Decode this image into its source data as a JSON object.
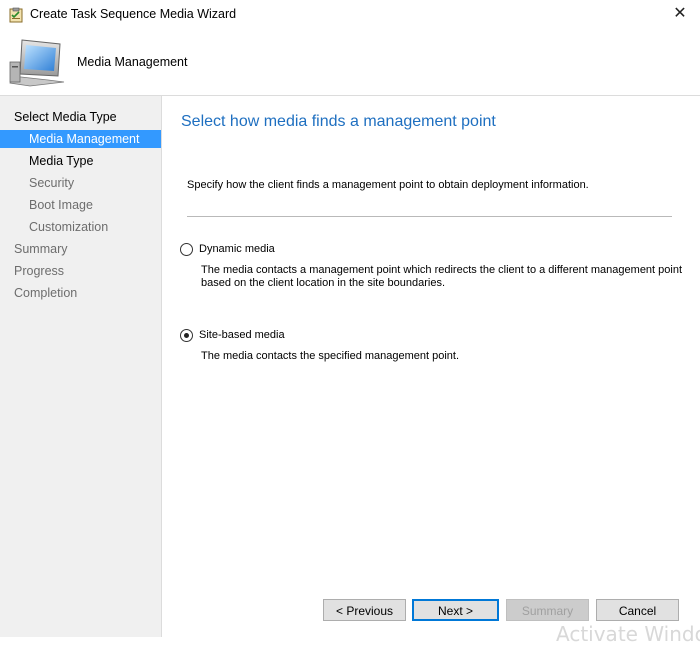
{
  "window": {
    "title": "Create Task Sequence Media Wizard",
    "close_glyph": "✕"
  },
  "header": {
    "title": "Media Management"
  },
  "nav": {
    "items": [
      {
        "label": "Select Media Type",
        "state": "normal"
      },
      {
        "label": "Media Management",
        "state": "selected"
      },
      {
        "label": "Media Type",
        "state": "normal"
      },
      {
        "label": "Security",
        "state": "dim"
      },
      {
        "label": "Boot Image",
        "state": "dim"
      },
      {
        "label": "Customization",
        "state": "dim"
      },
      {
        "label": "Summary",
        "state": "dim"
      },
      {
        "label": "Progress",
        "state": "dim"
      },
      {
        "label": "Completion",
        "state": "dim"
      }
    ]
  },
  "main": {
    "heading": "Select how media finds a management point",
    "instruction": "Specify how the client finds a management point to obtain deployment information.",
    "options": [
      {
        "label": "Dynamic media",
        "checked": false,
        "description_lines": [
          "The media contacts a management point which redirects the client to a different management point",
          "based on the client location in the site boundaries."
        ]
      },
      {
        "label": "Site-based media",
        "checked": true,
        "description_lines": [
          "The media contacts the specified management point."
        ]
      }
    ]
  },
  "buttons": {
    "previous": "< Previous",
    "next": "Next >",
    "summary": "Summary",
    "cancel": "Cancel"
  },
  "watermark": "Activate Windows",
  "colors": {
    "accent": "#3399ff",
    "heading": "#1e6fc0",
    "nav_background": "#f0f0f0"
  },
  "icons": {
    "title": "wizard-clipboard-icon",
    "header": "computer-monitor-icon",
    "close": "close-icon"
  }
}
